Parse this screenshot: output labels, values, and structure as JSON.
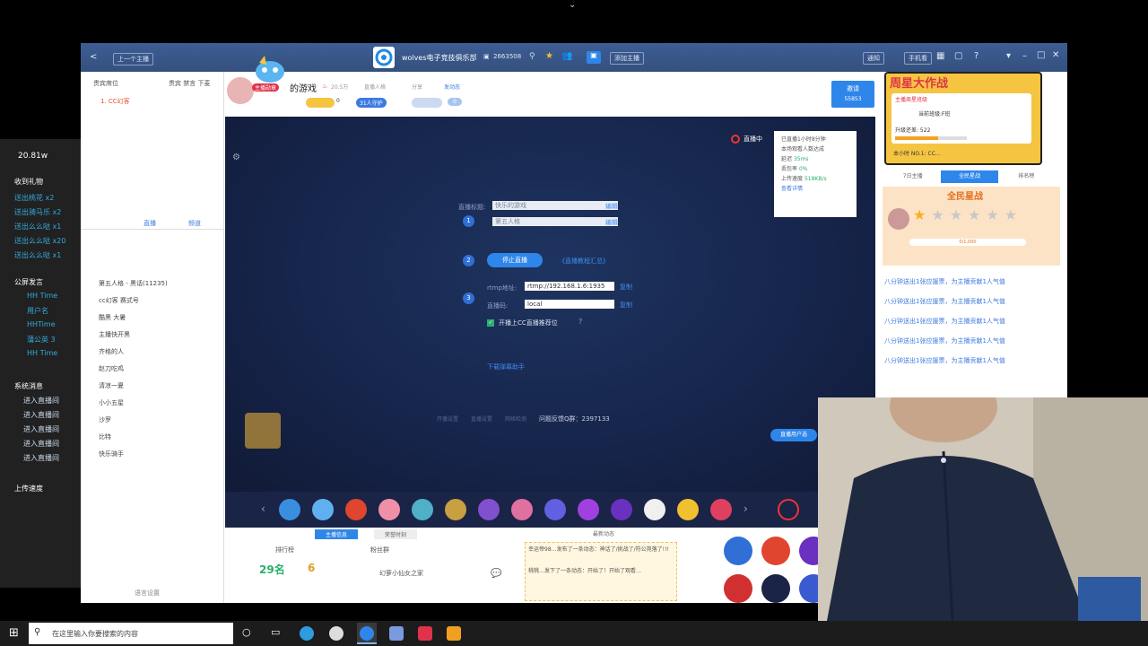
{
  "top_chevron": "⌄",
  "window": {
    "back_label": "<",
    "prev_anchor": "上一个主播",
    "room_title": "wolves电子竞技俱乐部",
    "room_id": "2663508",
    "add_anchor": "添加主播",
    "notify": "通知",
    "phone": "手机看"
  },
  "left_panel": {
    "tabs": [
      "贵宾席位",
      "贵宾 禁言 下麦"
    ],
    "first_entry": "1. CC幻客",
    "rows": [
      "第五人格 - 黑话(11235)",
      "cc幻客 赛式号",
      "酷黑 大暑",
      "主播快开黑",
      "齐格的人",
      "赵刀吃鸡",
      "清凉一夏",
      "小小五星",
      "沙罗",
      "比特",
      "快乐骑手"
    ],
    "chat_tabs": [
      "直播",
      "频道"
    ],
    "bottom": "语言设置"
  },
  "stream_header": {
    "game": "的游戏",
    "heat": "20.5万",
    "follow": "直播人格",
    "share": "分享",
    "gift_tag": "发动态",
    "level_badge": "主播勋章",
    "fans": "31人守护",
    "count": "0",
    "invite": "邀请",
    "invite_count": "55853",
    "zero_badge": "0"
  },
  "preview": {
    "live_label": "直播中",
    "stats": {
      "started": "已直播1小时8分钟",
      "reach": "本场观看人数达成",
      "delay_label": "延迟",
      "delay": "35ms",
      "loss_label": "丢包率",
      "loss": "0%",
      "speed_label": "上传速度",
      "speed": "518KB/s",
      "health": "查看详情"
    },
    "title_label": "直播标题:",
    "title_value": "快乐的游戏",
    "edit": "编辑",
    "category_value": "第五人格",
    "stop_button": "停止直播",
    "tutorial": "《直播教程汇总》",
    "rtmp_label": "rtmp地址:",
    "rtmp_value": "rtmp://192.168.1.6:1935",
    "key_label": "直播码:",
    "key_value": "local",
    "copy": "复制",
    "checkbox_label": "开播上CC直播推荐位",
    "download": "下载弹幕助手",
    "footer_items": [
      "开播设置",
      "直播设置",
      "网络检测"
    ],
    "feedback": "问题反馈Q群：2397133",
    "promo": "直播用户选"
  },
  "bottom": {
    "tabs": [
      "主播信息",
      "荣誉时刻"
    ],
    "dynamic": "最新动态",
    "rank_label": "排行榜",
    "rank_value": "29名",
    "fans_label": "粉丝群",
    "fans_value": "6",
    "fan_name": "幻萝小仙女之家",
    "news": [
      "幸运帝98…发布了一条动态：神话了/挑战了/符公苑落了!!!",
      "桃桃…发下了一条动态：开始了！开始了观看…"
    ],
    "icons": [
      "积分商城",
      "抽奖",
      "主播",
      "福利",
      "守护榜",
      "游戏"
    ]
  },
  "right_panel": {
    "event_title": "周星大作战",
    "event_sub": "主播周星班级",
    "class_label": "当前班级:F班",
    "upgrade": "升级还差: 522",
    "rank": "本小时 NO.1: CC…",
    "tabs": [
      "7日主播",
      "全民星战",
      "排名榜"
    ],
    "star_title": "全民星战",
    "progress": "0/1,000",
    "feed": [
      "八分钟送出1张应援票，为主播贡献1人气值",
      "八分钟送出1张应援票，为主播贡献1人气值",
      "八分钟送出1张应援票，为主播贡献1人气值",
      "八分钟送出1张应援票，为主播贡献1人气值",
      "八分钟送出1张应援票，为主播贡献1人气值"
    ]
  },
  "overlay": {
    "speed": "20.81w",
    "gift_header": "收到礼物",
    "gifts": [
      "送出桃花 x2",
      "送出骑马乐 x2",
      "送出么么哒 x1",
      "送出么么哒 x20",
      "送出么么哒 x1"
    ],
    "public_header": "公屏发言",
    "public": [
      "HH Time",
      "用户名",
      "HHTime",
      "蒲公英 3",
      "HH Time"
    ],
    "system_header": "系统消息",
    "system": [
      "进入直播间",
      "进入直播间",
      "进入直播间",
      "进入直播间",
      "进入直播间"
    ],
    "upload": "上传速度"
  },
  "taskbar": {
    "search_placeholder": "在这里输入你要搜索的内容"
  }
}
